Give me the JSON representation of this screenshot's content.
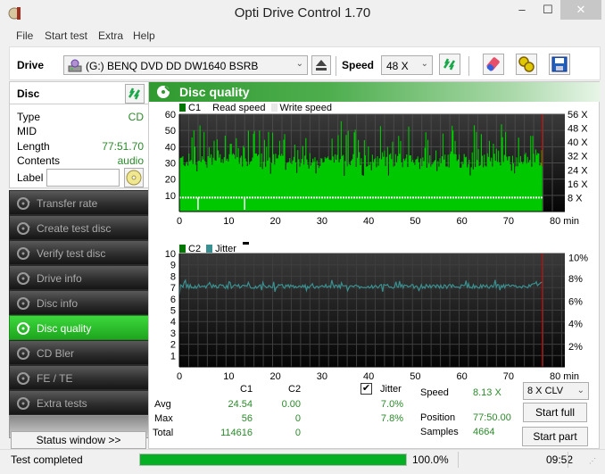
{
  "window": {
    "title": "Opti Drive Control 1.70",
    "controls": {
      "minimize": "–",
      "maximize": "☐",
      "close": "✕"
    }
  },
  "menu": [
    "File",
    "Start test",
    "Extra",
    "Help"
  ],
  "toolbar": {
    "drive_label": "Drive",
    "drive_value": "(G:)  BENQ DVD DD DW1640 BSRB",
    "speed_label": "Speed",
    "speed_value": "48 X"
  },
  "disc": {
    "title": "Disc",
    "rows": [
      {
        "key": "Type",
        "value": "CD"
      },
      {
        "key": "MID",
        "value": ""
      },
      {
        "key": "Length",
        "value": "77:51.70"
      },
      {
        "key": "Contents",
        "value": "audio"
      }
    ],
    "label_key": "Label",
    "label_value": ""
  },
  "nav": [
    {
      "label": "Transfer rate",
      "active": false
    },
    {
      "label": "Create test disc",
      "active": false
    },
    {
      "label": "Verify test disc",
      "active": false
    },
    {
      "label": "Drive info",
      "active": false
    },
    {
      "label": "Disc info",
      "active": false
    },
    {
      "label": "Disc quality",
      "active": true
    },
    {
      "label": "CD Bler",
      "active": false
    },
    {
      "label": "FE / TE",
      "active": false
    },
    {
      "label": "Extra tests",
      "active": false
    }
  ],
  "status_window_button": "Status window >>",
  "main": {
    "title": "Disc quality",
    "legend_top": {
      "c1": "C1",
      "read": "Read speed",
      "write": "Write speed"
    },
    "legend_bottom": {
      "c2": "C2",
      "jitter": "Jitter"
    }
  },
  "colors": {
    "c1": "#00c800",
    "c1_legend": "#007800",
    "jitter": "#3a9090",
    "marker": "#e00000",
    "accent": "#2f9a2f"
  },
  "chart_data": [
    {
      "type": "bar",
      "title": "C1",
      "xlabel": "min",
      "x_ticks": [
        "0",
        "10",
        "20",
        "30",
        "40",
        "50",
        "60",
        "70",
        "80 min"
      ],
      "y_ticks_left": [
        "10",
        "20",
        "30",
        "40",
        "50",
        "60"
      ],
      "y_ticks_right": [
        "8 X",
        "16 X",
        "24 X",
        "32 X",
        "40 X",
        "48 X",
        "56 X"
      ],
      "xlim": [
        0,
        80
      ],
      "ylim": [
        0,
        60
      ],
      "y2lim": [
        0,
        56
      ],
      "grid": true,
      "end_marker_min": 77.85,
      "series": [
        {
          "name": "C1",
          "avg": 24.54,
          "max": 56,
          "typical_range": [
            25,
            40
          ]
        },
        {
          "name": "Read speed",
          "approx_value_x": 8,
          "dips_at_min": [
            4,
            14
          ]
        }
      ]
    },
    {
      "type": "line",
      "title": "C2 / Jitter",
      "xlabel": "min",
      "x_ticks": [
        "0",
        "10",
        "20",
        "30",
        "40",
        "50",
        "60",
        "70",
        "80 min"
      ],
      "y_ticks_left": [
        "1",
        "2",
        "3",
        "4",
        "5",
        "6",
        "7",
        "8",
        "9",
        "10"
      ],
      "y_ticks_right": [
        "2%",
        "4%",
        "6%",
        "8%",
        "10%"
      ],
      "xlim": [
        0,
        80
      ],
      "ylim": [
        0,
        10
      ],
      "y2lim": [
        0,
        10
      ],
      "grid": true,
      "end_marker_min": 77.85,
      "series": [
        {
          "name": "C2",
          "values": [
            0
          ]
        },
        {
          "name": "Jitter",
          "avg": 7.0,
          "max": 7.8,
          "unit": "%"
        }
      ]
    }
  ],
  "stats": {
    "col_c1": "C1",
    "col_c2": "C2",
    "jitter_label": "Jitter",
    "jitter_checked": true,
    "rows": [
      {
        "label": "Avg",
        "c1": "24.54",
        "c2": "0.00",
        "jitter": "7.0%"
      },
      {
        "label": "Max",
        "c1": "56",
        "c2": "0",
        "jitter": "7.8%"
      },
      {
        "label": "Total",
        "c1": "114616",
        "c2": "0",
        "jitter": ""
      }
    ],
    "speed_label": "Speed",
    "speed_value": "8.13 X",
    "position_label": "Position",
    "position_value": "77:50.00",
    "samples_label": "Samples",
    "samples_value": "4664"
  },
  "controls": {
    "mode_value": "8 X CLV",
    "start_full": "Start full",
    "start_part": "Start part"
  },
  "statusbar": {
    "message": "Test completed",
    "progress": 1.0,
    "percent_text": "100.0%",
    "time": "09:52"
  }
}
